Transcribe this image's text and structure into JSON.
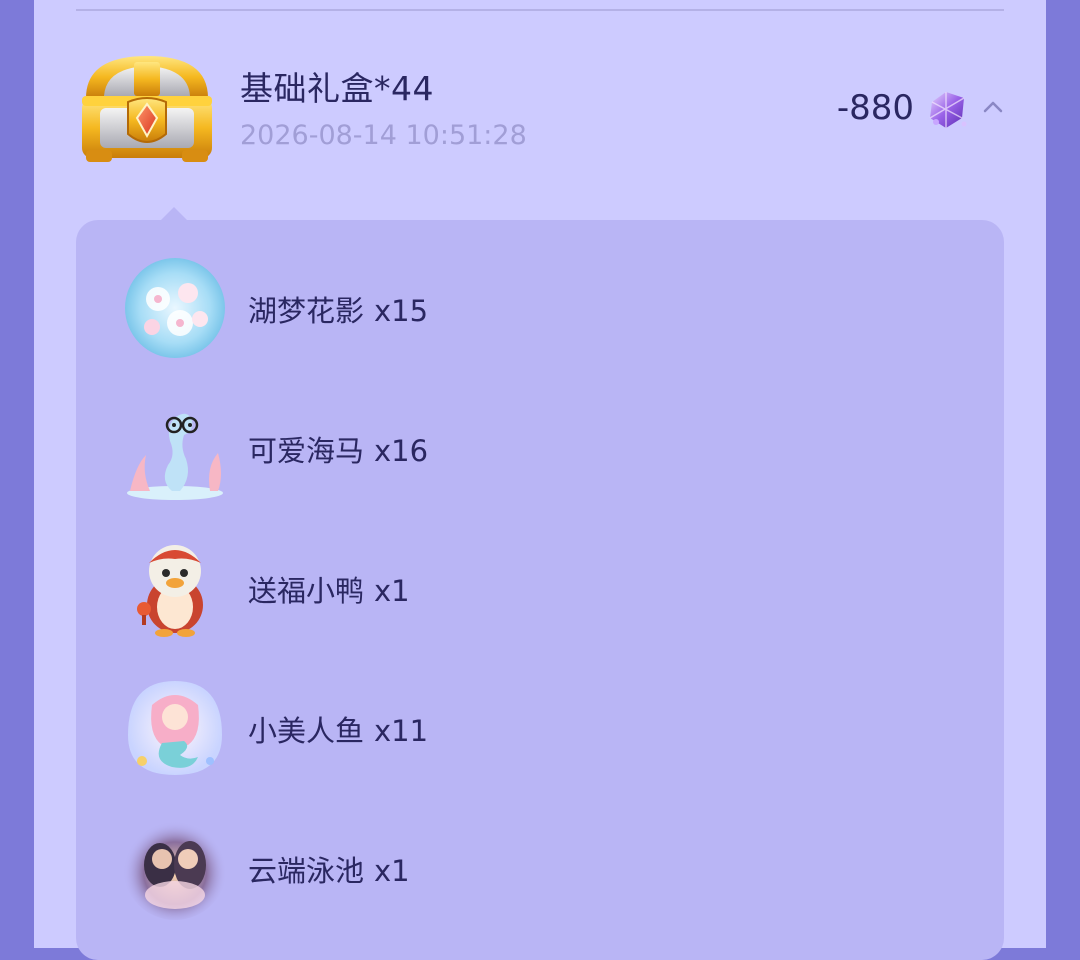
{
  "record": {
    "title": "基础礼盒*44",
    "timestamp": "2026-08-14 10:51:28",
    "amount": "-880",
    "icons": {
      "box": "treasure-chest-icon",
      "currency": "purple-gem-icon",
      "toggle": "chevron-up-icon"
    }
  },
  "items": [
    {
      "name": "湖梦花影",
      "qty": "x15",
      "icon": "flower-orb-icon"
    },
    {
      "name": "可爱海马",
      "qty": "x16",
      "icon": "seahorse-icon"
    },
    {
      "name": "送福小鸭",
      "qty": "x1",
      "icon": "lucky-duck-icon"
    },
    {
      "name": "小美人鱼",
      "qty": "x11",
      "icon": "mermaid-icon"
    },
    {
      "name": "云端泳池",
      "qty": "x1",
      "icon": "cloud-pool-couple-icon"
    }
  ],
  "colors": {
    "background": "#7d7ad9",
    "panel": "#cdcbff",
    "detail_panel": "#b9b5f5",
    "primary_text": "#2a2761",
    "secondary_text": "#a19ed6"
  }
}
